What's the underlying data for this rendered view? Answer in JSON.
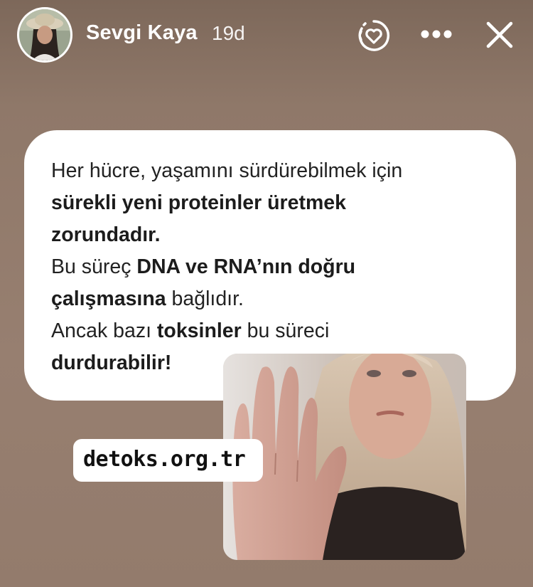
{
  "story": {
    "user": {
      "name": "Sevgi Kaya",
      "time_ago": "19d",
      "avatar_icon": "profile-photo"
    },
    "header_icons": {
      "like": "heart-circle-icon",
      "more": "more-dots-icon",
      "close": "close-icon"
    }
  },
  "card": {
    "line1_regular": "Her hücre, yaşamını sürdürebilmek için",
    "line2_bold": "sürekli yeni proteinler üretmek",
    "line3_bold": "zorundadır.",
    "line4_regular": "Bu süreç ",
    "line4_bold": "DNA ve RNA’nın doğru",
    "line5_bold": "çalışmasına",
    "line5_regular": " bağlıdır.",
    "line6_regular_a": "Ancak bazı ",
    "line6_bold": "toksinler",
    "line6_regular_b": " bu süreci",
    "line7_bold": "durdurabilir!"
  },
  "website": {
    "label": "detoks.org.tr"
  },
  "photo": {
    "description_icon": "woman-stop-hand-photo"
  },
  "colors": {
    "background": "#8d7668",
    "card": "#ffffff",
    "text": "#222222"
  }
}
